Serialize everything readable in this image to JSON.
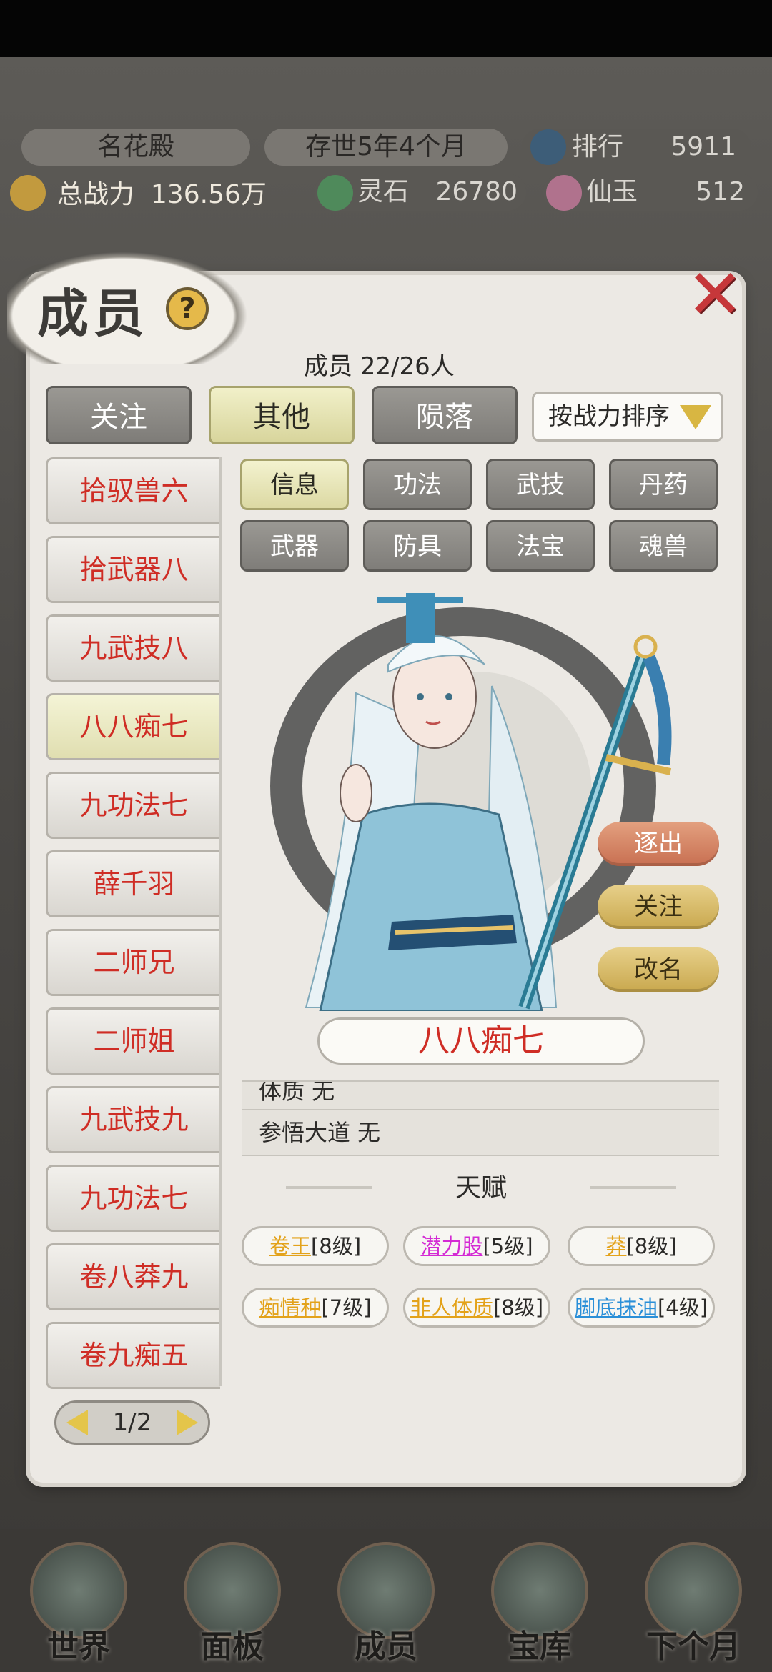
{
  "top": {
    "sect_name": "名花殿",
    "existence": "存世5年4个月",
    "rank_label": "排行",
    "rank_value": "5911",
    "power_label": "总战力",
    "power_value": "136.56万",
    "spirit_stone_label": "灵石",
    "spirit_stone_value": "26780",
    "jade_label": "仙玉",
    "jade_value": "512"
  },
  "dialog": {
    "title": "成员",
    "help": "?",
    "close": "✕",
    "member_count": "成员  22/26人",
    "filters": [
      "关注",
      "其他",
      "陨落"
    ],
    "active_filter": 1,
    "sort_label": "按战力排序"
  },
  "members": [
    "拾驭兽六",
    "拾武器八",
    "九武技八",
    "八八痴七",
    "九功法七",
    "薛千羽",
    "二师兄",
    "二师姐",
    "九武技九",
    "九功法七",
    "卷八莽九",
    "卷九痴五"
  ],
  "active_member": 3,
  "detail_tabs": [
    "信息",
    "功法",
    "武技",
    "丹药",
    "武器",
    "防具",
    "法宝",
    "魂兽"
  ],
  "active_tab": 0,
  "actions": {
    "expel": "逐出",
    "follow": "关注",
    "rename": "改名"
  },
  "selected_name": "八八痴七",
  "info_lines": [
    "体质 无",
    "参悟大道 无"
  ],
  "talent_title": "天赋",
  "talents": [
    {
      "name": "卷王",
      "level": "[8级]",
      "color": "#e3a21a"
    },
    {
      "name": "潜力股",
      "level": "[5级]",
      "color": "#d42ad4"
    },
    {
      "name": "莽",
      "level": "[8级]",
      "color": "#e3a21a"
    },
    {
      "name": "痴情种",
      "level": "[7级]",
      "color": "#e3a21a"
    },
    {
      "name": "非人体质",
      "level": "[8级]",
      "color": "#e3a21a"
    },
    {
      "name": "脚底抹油",
      "level": "[4级]",
      "color": "#2a8fd8"
    }
  ],
  "pager": "1/2",
  "nav": [
    "世界",
    "面板",
    "成员",
    "宝库",
    "下个月"
  ]
}
